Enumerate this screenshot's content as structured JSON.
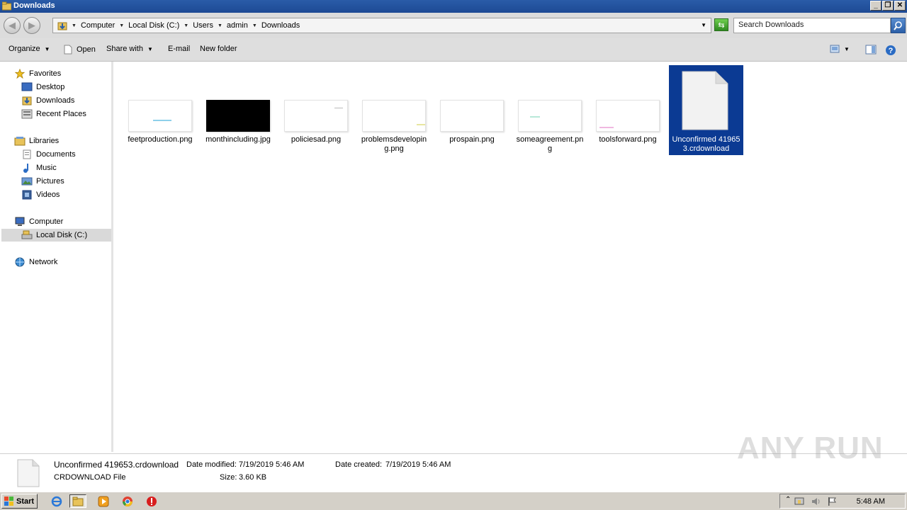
{
  "window": {
    "title": "Downloads"
  },
  "address": {
    "crumbs": [
      "Computer",
      "Local Disk (C:)",
      "Users",
      "admin",
      "Downloads"
    ],
    "search_placeholder": "Search Downloads"
  },
  "toolbar": {
    "organize": "Organize",
    "open": "Open",
    "share_with": "Share with",
    "email": "E-mail",
    "new_folder": "New folder"
  },
  "nav": {
    "favorites": "Favorites",
    "desktop": "Desktop",
    "downloads": "Downloads",
    "recent_places": "Recent Places",
    "libraries": "Libraries",
    "documents": "Documents",
    "music": "Music",
    "pictures": "Pictures",
    "videos": "Videos",
    "computer": "Computer",
    "local_disk": "Local Disk (C:)",
    "network": "Network"
  },
  "files": [
    {
      "name": "feetproduction.png"
    },
    {
      "name": "monthincluding.jpg"
    },
    {
      "name": "policiesad.png"
    },
    {
      "name": "problemsdeveloping.png"
    },
    {
      "name": "prospain.png"
    },
    {
      "name": "someagreement.png"
    },
    {
      "name": "toolsforward.png"
    },
    {
      "name": "Unconfirmed 419653.crdownload"
    }
  ],
  "details": {
    "file_name": "Unconfirmed 419653.crdownload",
    "file_type": "CRDOWNLOAD File",
    "date_modified_label": "Date modified:",
    "date_modified": "7/19/2019 5:46 AM",
    "date_created_label": "Date created:",
    "date_created": "7/19/2019 5:46 AM",
    "size_label": "Size:",
    "size": "3.60 KB"
  },
  "taskbar": {
    "start": "Start",
    "clock": "5:48 AM"
  },
  "watermark": "ANY RUN",
  "colors": {
    "selection": "#0b3a93",
    "titlebar": "#1d4a94"
  }
}
